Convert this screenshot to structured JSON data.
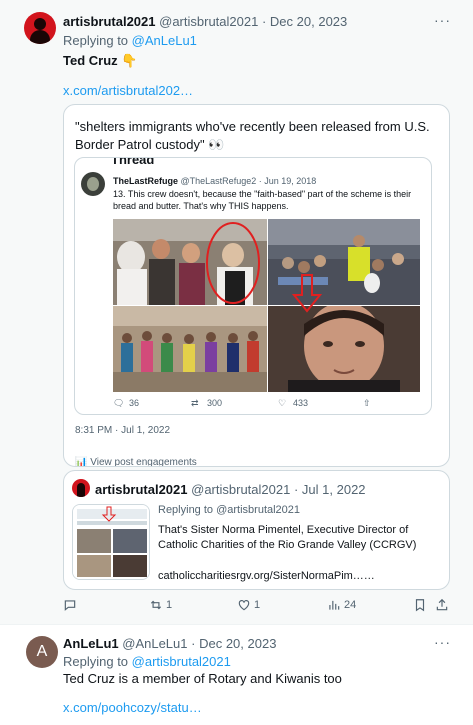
{
  "tweet1": {
    "name": "artisbrutal2021",
    "handle": "@artisbrutal2021",
    "date": "Dec 20, 2023",
    "more": "···",
    "replying_prefix": "Replying to ",
    "replying_to": "@AnLeLu1",
    "text": "Ted Cruz 👇",
    "url": "x.com/artisbrutal202…",
    "quote": {
      "text": "\"shelters immigrants who've recently been released from U.S. Border Patrol custody\" 👀",
      "thread_label": "Thread",
      "inner": {
        "name": "TheLastRefuge",
        "handle": "@TheLastRefuge2",
        "date": "Jun 19, 2018",
        "text": "13.   This crew doesn't, because the \"faith-based\" part of the scheme is their bread and butter.  That's why THIS happens.",
        "replies": "36",
        "retweets": "300",
        "likes": "433"
      },
      "timestamp": "8:31 PM · Jul 1, 2022",
      "engagements": "View post engagements"
    },
    "quote2": {
      "name": "artisbrutal2021",
      "handle": "@artisbrutal2021",
      "date": "Jul 1, 2022",
      "replying_prefix": "Replying to ",
      "replying_to": "@artisbrutal2021",
      "text": "That's Sister Norma Pimentel, Executive Director of Catholic Charities of the Rio Grande Valley  (CCRGV)",
      "url": "catholiccharitiesrgv.org/SisterNormaPim……"
    },
    "actions": {
      "reposts": "1",
      "likes": "1",
      "views": "24"
    }
  },
  "tweet2": {
    "avatar_letter": "A",
    "name": "AnLeLu1",
    "handle": "@AnLeLu1",
    "date": "Dec 20, 2023",
    "more": "···",
    "replying_prefix": "Replying to ",
    "replying_to": "@artisbrutal2021",
    "text": "Ted Cruz is a member of Rotary and Kiwanis too",
    "url": "x.com/poohcozy/statu…"
  },
  "colors": {
    "link": "#1d9bf0",
    "muted": "#536471",
    "annotation_red": "#e02020",
    "annotation_green": "#2fa52f"
  }
}
